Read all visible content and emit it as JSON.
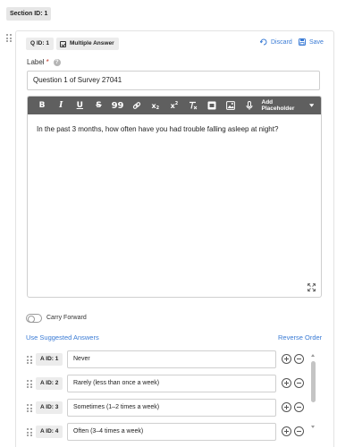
{
  "section": {
    "label": "Section ID: 1"
  },
  "question": {
    "qid_label": "Q ID: 1",
    "type_label": "Multiple Answer",
    "discard_label": "Discard",
    "save_label": "Save",
    "field_label": "Label",
    "required_mark": "*",
    "help_glyph": "?",
    "label_value": "Question 1 of Survey 27041"
  },
  "editor": {
    "toolbar": {
      "bold": "B",
      "italic": "I",
      "underline": "U",
      "strike": "S",
      "quote": "99",
      "link": "link-icon",
      "subscript": "x2",
      "superscript": "x2",
      "clear_format": "clear-format-icon",
      "add_placeholder_label": "Add Placeholder"
    },
    "body_text": "In the past 3 months, how often have you had trouble falling asleep at night?"
  },
  "carry_forward": {
    "label": "Carry Forward",
    "enabled": false
  },
  "answers_header": {
    "suggested_label": "Use Suggested Answers",
    "reverse_label": "Reverse Order"
  },
  "answers": [
    {
      "aid": "A ID: 1",
      "text": "Never"
    },
    {
      "aid": "A ID: 2",
      "text": "Rarely (less than once a week)"
    },
    {
      "aid": "A ID: 3",
      "text": "Sometimes (1–2 times a week)"
    },
    {
      "aid": "A ID: 4",
      "text": "Often (3–4 times a week)"
    }
  ],
  "colors": {
    "accent": "#3a7bd5",
    "toolbar": "#5f5f5f",
    "required": "#c0392b"
  }
}
